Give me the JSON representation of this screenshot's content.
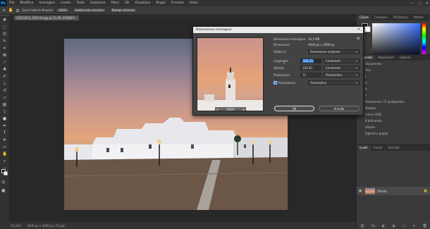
{
  "app": {
    "logo": "Ps",
    "menu": [
      "File",
      "Modifica",
      "Immagine",
      "Livello",
      "Testo",
      "Selezione",
      "Filtro",
      "3D",
      "Visualizza",
      "Plugin",
      "Finestra",
      "Aiuto"
    ]
  },
  "options_bar": {
    "scroll_all": "Scorri tutte le finestre",
    "zoom": "100%",
    "fit_screen": "Adatta allo schermo",
    "fill_screen": "Riempi schermo"
  },
  "document": {
    "tab_title": "20221012_190134.jpg @ 33,3% (RGB/8*)",
    "status_zoom": "33,33%",
    "status_info": "4000 px x 3000 px (72 ppi)"
  },
  "dialog": {
    "title": "Dimensione immagine",
    "preview_zoom": "100%",
    "size_label": "Dimensione immagine:",
    "size_value": "34,3 MB",
    "dims_label": "Dimensioni:",
    "dims_value": "4000 px x 3000 px",
    "fit_label": "Adatta a:",
    "fit_value": "Dimensione originale",
    "width_label": "Larghezza:",
    "width_value": "141,11",
    "width_unit": "Centimetri",
    "height_label": "Altezza:",
    "height_value": "105,83",
    "height_unit": "Centimetri",
    "res_label": "Risoluzione:",
    "res_value": "72",
    "res_unit": "Pixel/pollice",
    "resample_label": "Ricampiona:",
    "resample_value": "Automatica",
    "ok": "OK",
    "cancel": "Annulla"
  },
  "color_panel": {
    "tabs": [
      "Colore",
      "Campioni",
      "Sfumature",
      "Pattern"
    ]
  },
  "properties_panel": {
    "tabs": [
      "Proprietà",
      "Regolazioni",
      "Librerie"
    ],
    "doc_label": "Documento",
    "tela_label": "Tela",
    "rows": [
      "L",
      "A",
      "X",
      "Y",
      "Risoluzione: 72 pixel/pollice",
      "Metodo",
      "Colore RGB",
      "8 bit/canale",
      "Sfondo",
      "Righelli e griglie"
    ]
  },
  "layers_panel": {
    "tabs": [
      "Livelli",
      "Canali",
      "Tracciati"
    ],
    "layer_name": "Sfondo"
  },
  "icons": {
    "close": "close-icon",
    "gear": "gear-icon",
    "link": "link-icon",
    "eye": "eye-icon",
    "lock": "lock-icon"
  }
}
